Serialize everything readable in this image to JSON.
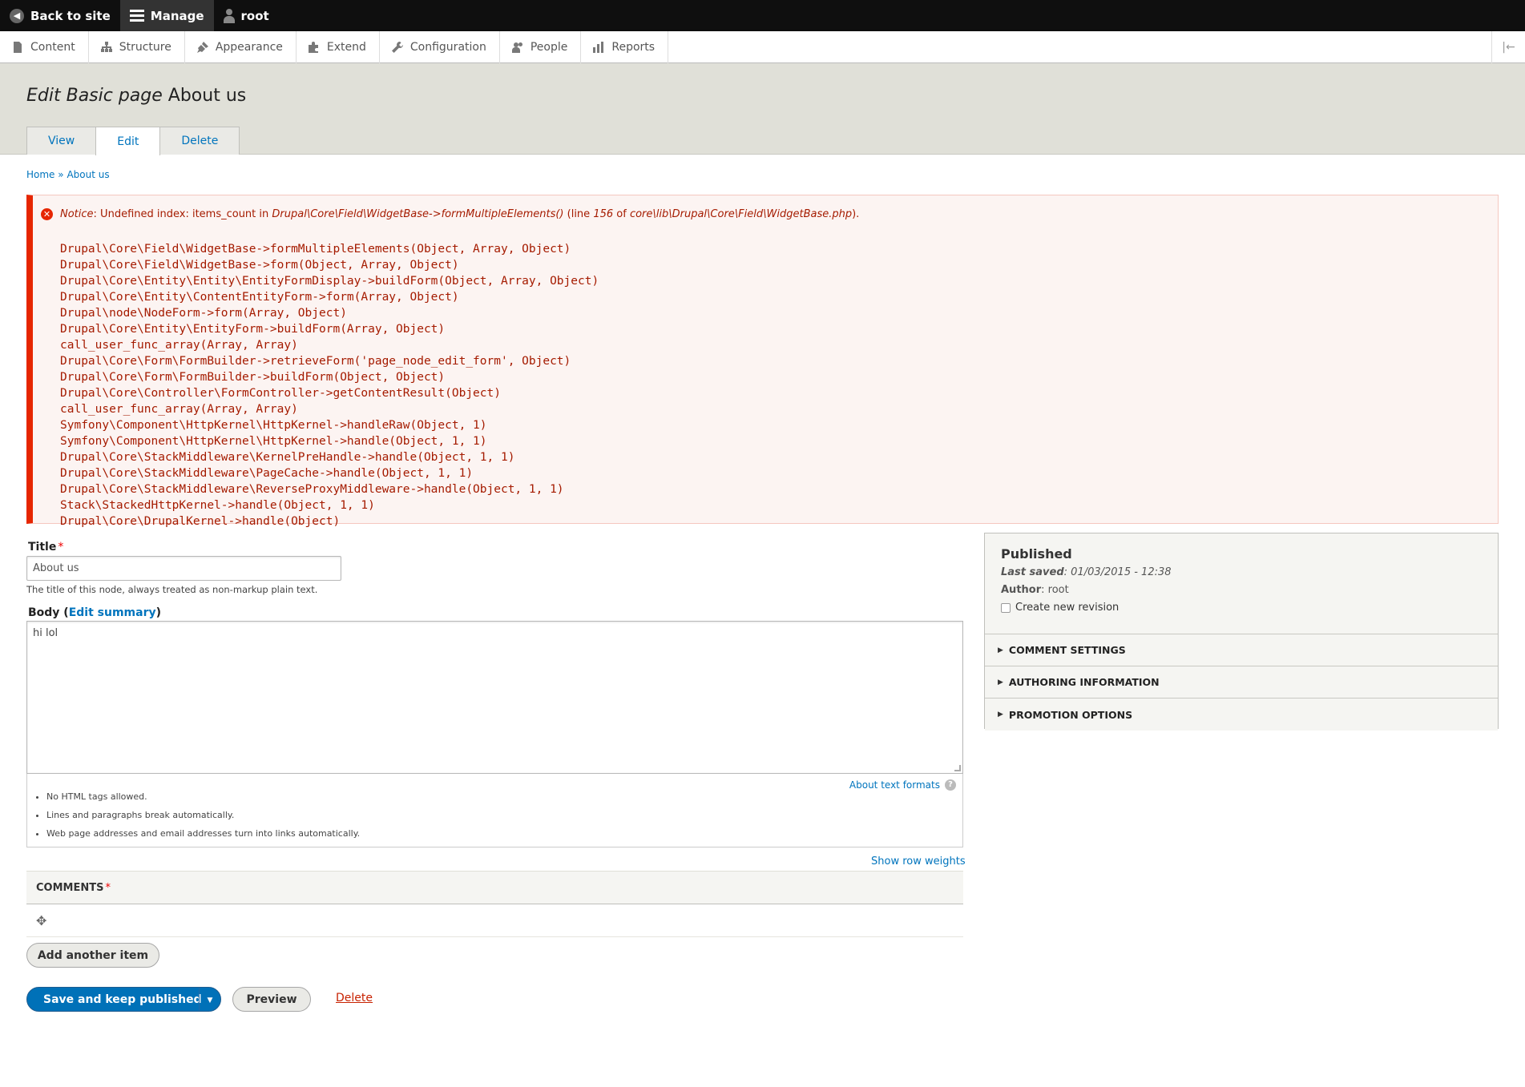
{
  "toolbar": {
    "back_label": "Back to site",
    "manage_label": "Manage",
    "user_label": "root"
  },
  "tray": {
    "items": [
      "Content",
      "Structure",
      "Appearance",
      "Extend",
      "Configuration",
      "People",
      "Reports"
    ]
  },
  "header": {
    "title_prefix": "Edit Basic page",
    "title_node": "About us",
    "tabs": [
      "View",
      "Edit",
      "Delete"
    ],
    "active_tab": "Edit"
  },
  "breadcrumb": {
    "home": "Home",
    "sep": "»",
    "current": "About us"
  },
  "error": {
    "type": "Notice",
    "message": ": Undefined index: items_count in ",
    "function": "Drupal\\Core\\Field\\WidgetBase->formMultipleElements()",
    "line_text": " (line ",
    "line_number": "156",
    "of_text": " of ",
    "file": "core\\lib\\Drupal\\Core\\Field\\WidgetBase.php",
    "end": ").",
    "trace": [
      "Drupal\\Core\\Field\\WidgetBase->formMultipleElements(Object, Array, Object)",
      "Drupal\\Core\\Field\\WidgetBase->form(Object, Array, Object)",
      "Drupal\\Core\\Entity\\Entity\\EntityFormDisplay->buildForm(Object, Array, Object)",
      "Drupal\\Core\\Entity\\ContentEntityForm->form(Array, Object)",
      "Drupal\\node\\NodeForm->form(Array, Object)",
      "Drupal\\Core\\Entity\\EntityForm->buildForm(Array, Object)",
      "call_user_func_array(Array, Array)",
      "Drupal\\Core\\Form\\FormBuilder->retrieveForm('page_node_edit_form', Object)",
      "Drupal\\Core\\Form\\FormBuilder->buildForm(Object, Object)",
      "Drupal\\Core\\Controller\\FormController->getContentResult(Object)",
      "call_user_func_array(Array, Array)",
      "Symfony\\Component\\HttpKernel\\HttpKernel->handleRaw(Object, 1)",
      "Symfony\\Component\\HttpKernel\\HttpKernel->handle(Object, 1, 1)",
      "Drupal\\Core\\StackMiddleware\\KernelPreHandle->handle(Object, 1, 1)",
      "Drupal\\Core\\StackMiddleware\\PageCache->handle(Object, 1, 1)",
      "Drupal\\Core\\StackMiddleware\\ReverseProxyMiddleware->handle(Object, 1, 1)",
      "Stack\\StackedHttpKernel->handle(Object, 1, 1)",
      "Drupal\\Core\\DrupalKernel->handle(Object)"
    ]
  },
  "form": {
    "title_label": "Title",
    "title_value": "About us",
    "title_desc": "The title of this node, always treated as non-markup plain text.",
    "body_label": "Body",
    "body_summary_link": "Edit summary",
    "body_value": "hi lol",
    "about_formats": "About text formats",
    "format_tips": [
      "No HTML tags allowed.",
      "Lines and paragraphs break automatically.",
      "Web page addresses and email addresses turn into links automatically."
    ],
    "row_weights": "Show row weights",
    "comments_label": "COMMENTS",
    "add_item": "Add another item",
    "save_label": "Save and keep published",
    "preview_label": "Preview",
    "delete_label": "Delete"
  },
  "sidebar": {
    "status": "Published",
    "last_saved_label": "Last saved",
    "last_saved_value": ": 01/03/2015 - 12:38",
    "author_label": "Author",
    "author_value": ": root",
    "revision_label": "Create new revision",
    "sections": [
      "COMMENT SETTINGS",
      "AUTHORING INFORMATION",
      "PROMOTION OPTIONS"
    ]
  },
  "colors": {
    "primary_button": "#0071b8",
    "error_border": "#e62600",
    "link": "#0074bd"
  }
}
